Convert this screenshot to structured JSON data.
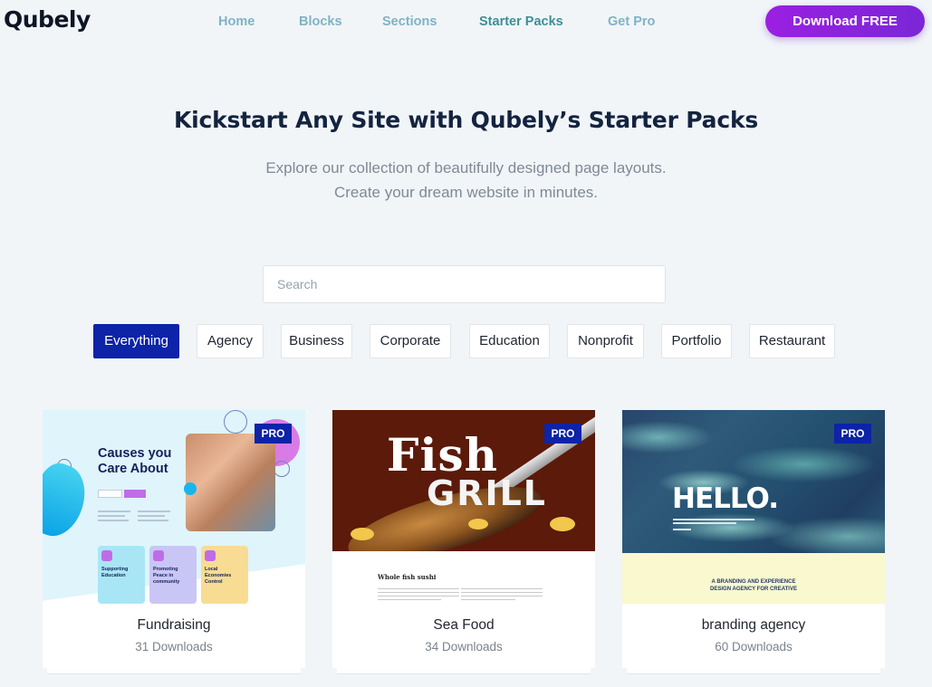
{
  "header": {
    "logo": "Qubely",
    "nav": [
      {
        "label": "Home",
        "active": false
      },
      {
        "label": "Blocks",
        "active": false
      },
      {
        "label": "Sections",
        "active": false
      },
      {
        "label": "Starter Packs",
        "active": true
      },
      {
        "label": "Get Pro",
        "active": false
      }
    ],
    "download_label": "Download FREE"
  },
  "hero": {
    "title": "Kickstart Any Site with Qubely’s Starter Packs",
    "subtitle_line1": "Explore our collection of beautifully designed page layouts.",
    "subtitle_line2": "Create your dream website in minutes."
  },
  "search": {
    "placeholder": "Search",
    "value": ""
  },
  "filters": [
    {
      "label": "Everything",
      "active": true
    },
    {
      "label": "Agency",
      "active": false
    },
    {
      "label": "Business",
      "active": false
    },
    {
      "label": "Corporate",
      "active": false
    },
    {
      "label": "Education",
      "active": false
    },
    {
      "label": "Nonprofit",
      "active": false
    },
    {
      "label": "Portfolio",
      "active": false
    },
    {
      "label": "Restaurant",
      "active": false
    }
  ],
  "cards": [
    {
      "name": "Fundraising",
      "downloads": "31 Downloads",
      "badge": "PRO",
      "preview": {
        "title": "Causes you Care About",
        "features": [
          "Supporting Education",
          "Promoting Peace in community",
          "Local Economies Control"
        ]
      }
    },
    {
      "name": "Sea Food",
      "downloads": "34 Downloads",
      "badge": "PRO",
      "preview": {
        "word1": "Fish",
        "word2": "GRILL",
        "heading": "Whole fish sushi"
      }
    },
    {
      "name": "branding agency",
      "downloads": "60 Downloads",
      "badge": "PRO",
      "preview": {
        "word": "HELLO.",
        "tagline": "A BRANDING AND EXPERIENCE DESIGN AGENCY FOR CREATIVE"
      }
    }
  ],
  "colors": {
    "accent_blue": "#0d23a8",
    "nav_teal": "#7fb3c4",
    "download_purple": "#8f22de",
    "page_bg": "#f1f5f8"
  }
}
